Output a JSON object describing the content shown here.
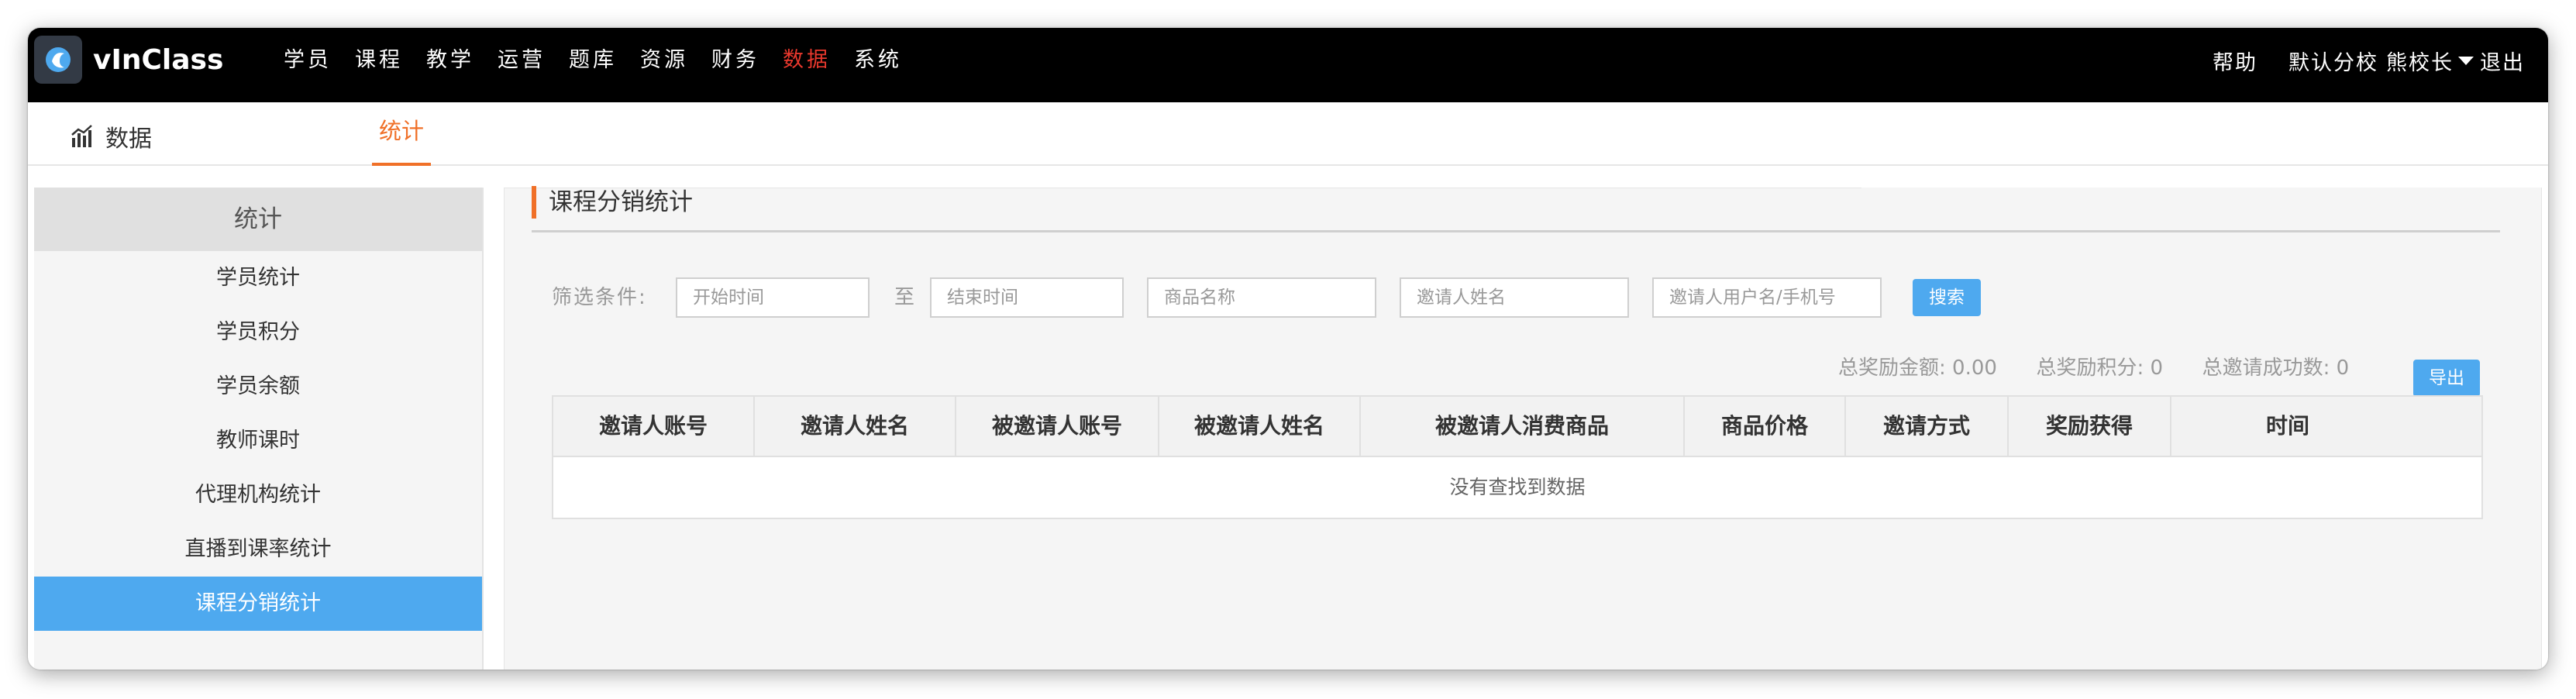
{
  "brand": {
    "name": "vInClass"
  },
  "nav": {
    "items": [
      "学员",
      "课程",
      "教学",
      "运营",
      "题库",
      "资源",
      "财务",
      "数据",
      "系统"
    ],
    "active_index": 7
  },
  "top_right": {
    "help": "帮助",
    "branch": "默认分校",
    "user": "熊校长",
    "logout": "退出"
  },
  "subbar": {
    "title": "数据",
    "tab": "统计"
  },
  "sidebar": {
    "heading": "统计",
    "items": [
      "学员统计",
      "学员积分",
      "学员余额",
      "教师课时",
      "代理机构统计",
      "直播到课率统计",
      "课程分销统计"
    ],
    "active_index": 6
  },
  "section": {
    "title": "课程分销统计"
  },
  "filters": {
    "label": "筛选条件:",
    "to": "至",
    "start_placeholder": "开始时间",
    "end_placeholder": "结束时间",
    "product_placeholder": "商品名称",
    "inviter_name_placeholder": "邀请人姓名",
    "inviter_account_placeholder": "邀请人用户名/手机号",
    "search_button": "搜索"
  },
  "summary": {
    "total_amount_label": "总奖励金额:",
    "total_amount": "0.00",
    "total_points_label": "总奖励积分:",
    "total_points": "0",
    "total_invites_label": "总邀请成功数:",
    "total_invites": "0",
    "export_button": "导出"
  },
  "table": {
    "columns": [
      "邀请人账号",
      "邀请人姓名",
      "被邀请人账号",
      "被邀请人姓名",
      "被邀请人消费商品",
      "商品价格",
      "邀请方式",
      "奖励获得",
      "时间"
    ],
    "empty_text": "没有查找到数据"
  },
  "colors": {
    "accent_orange": "#f07028",
    "active_nav_red": "#e8382d",
    "primary_blue": "#4ea9ef",
    "topbar_bg": "#000000"
  }
}
